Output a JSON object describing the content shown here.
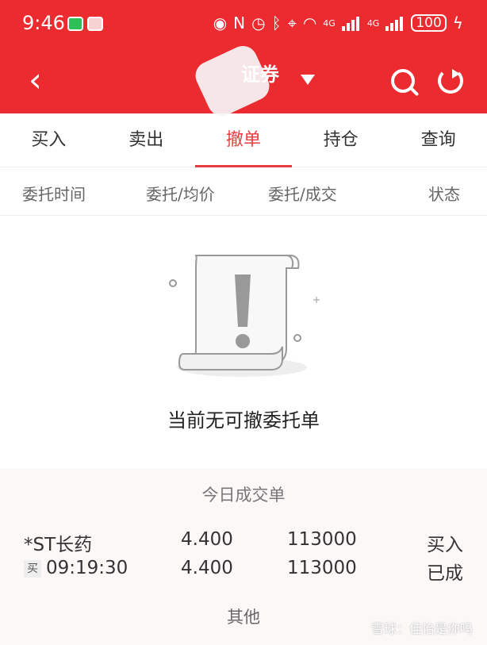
{
  "status_bar": {
    "time": "9:46",
    "battery": "100",
    "network_1": "4G",
    "network_2": "4G",
    "icons": [
      "wechat-icon",
      "news-icon",
      "eye-icon",
      "nfc-icon",
      "alarm-icon",
      "bluetooth-icon",
      "location-icon",
      "wifi-icon",
      "signal-icon",
      "charging-icon"
    ]
  },
  "header": {
    "title": "证券",
    "icons": [
      "back-icon",
      "dropdown-icon",
      "search-icon",
      "refresh-icon"
    ],
    "color": "#ec2b31"
  },
  "tabs": [
    "买入",
    "卖出",
    "撤单",
    "持仓",
    "查询"
  ],
  "active_tab": "撤单",
  "columns": [
    "委托时间",
    "委托/均价",
    "委托/成交",
    "状态"
  ],
  "empty_state": {
    "message": "当前无可撤委托单"
  },
  "today_trades": {
    "title": "今日成交单",
    "rows": [
      {
        "name": "*ST长药",
        "price": "4.400",
        "quantity": "113000",
        "status": "买入"
      },
      {
        "badge": "买",
        "time": "09:19:30",
        "price": "4.400",
        "quantity": "113000",
        "status": "已成"
      }
    ],
    "other_label": "其他"
  },
  "watermark": "雪球：佳怡是你吗",
  "accent_color": "#e93c3c"
}
